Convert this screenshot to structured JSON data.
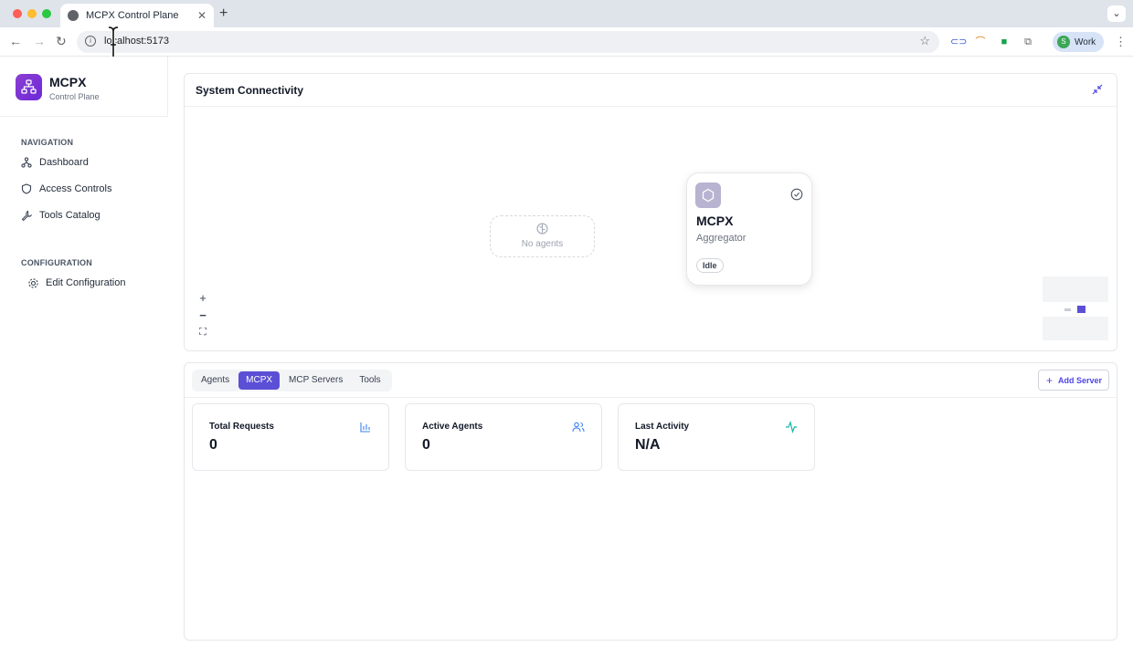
{
  "browser": {
    "tab_title": "MCPX Control Plane",
    "new_tab": "+",
    "url": "localhost:5173",
    "profile_initial": "S",
    "profile_label": "Work"
  },
  "sidebar": {
    "brand_name": "MCPX",
    "brand_subtitle": "Control Plane",
    "sections": [
      {
        "label": "NAVIGATION",
        "items": [
          {
            "label": "Dashboard",
            "icon": "network-icon"
          },
          {
            "label": "Access Controls",
            "icon": "shield-icon"
          },
          {
            "label": "Tools Catalog",
            "icon": "wrench-icon"
          }
        ]
      },
      {
        "label": "CONFIGURATION",
        "items": [
          {
            "label": "Edit Configuration",
            "icon": "gear-icon"
          }
        ]
      }
    ]
  },
  "connectivity": {
    "title": "System Connectivity",
    "no_agents": "No agents",
    "node": {
      "name": "MCPX",
      "role": "Aggregator",
      "status": "Idle"
    },
    "zoom_in": "+",
    "zoom_out": "−",
    "fit": "⛶"
  },
  "bottom": {
    "tabs": [
      {
        "label": "Agents",
        "active": false
      },
      {
        "label": "MCPX",
        "active": true
      },
      {
        "label": "MCP Servers",
        "active": false
      },
      {
        "label": "Tools",
        "active": false
      }
    ],
    "add_server": "Add Server",
    "cards": [
      {
        "label": "Total Requests",
        "value": "0",
        "icon": "bar-chart-icon"
      },
      {
        "label": "Active Agents",
        "value": "0",
        "icon": "users-icon"
      },
      {
        "label": "Last Activity",
        "value": "N/A",
        "icon": "activity-icon"
      }
    ]
  },
  "colors": {
    "accent": "#5b4fd6",
    "brand": "#7c3aed"
  }
}
